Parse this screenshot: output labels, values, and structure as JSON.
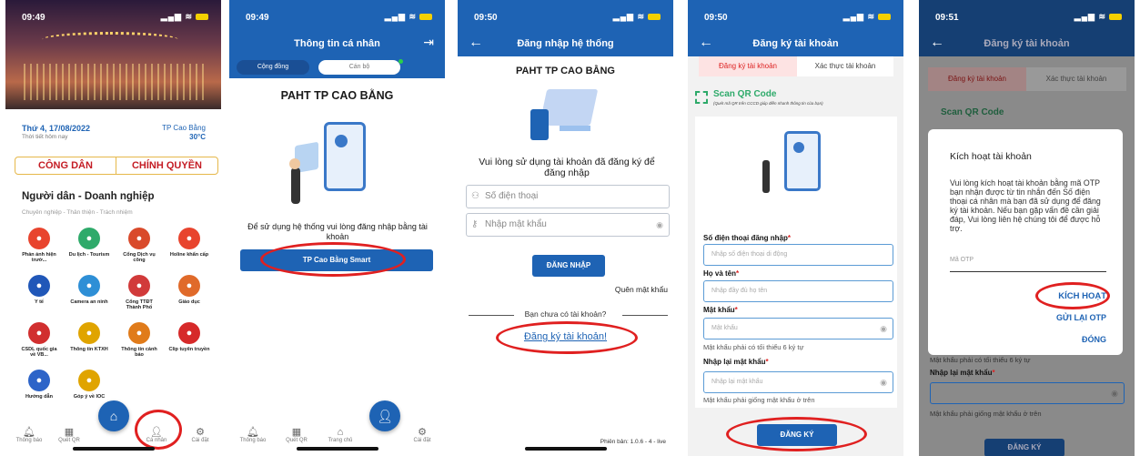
{
  "colors": {
    "brand_blue": "#1e63b4",
    "accent_red": "#d0112b",
    "annotation_red": "#e02020"
  },
  "s1": {
    "time": "09:49",
    "date": "Thứ 4, 17/08/2022",
    "weather_label": "Thời tiết hôm nay",
    "city": "TP Cao Bằng",
    "temp": "30°C",
    "tab_citizen": "CÔNG DÂN",
    "tab_gov": "CHÍNH QUYỀN",
    "section_title": "Người dân - Doanh nghiệp",
    "section_sub": "Chuyên nghiệp - Thân thiện - Trách nhiệm",
    "grid": [
      {
        "label": "Phản ánh hiện trườ...",
        "icon": "location-pin-icon",
        "color": "#e8442e"
      },
      {
        "label": "Du lịch - Tourism",
        "icon": "mountain-icon",
        "color": "#2eaa6a"
      },
      {
        "label": "Cổng Dịch vụ công",
        "icon": "service-portal-icon",
        "color": "#d94a2b"
      },
      {
        "label": "Holine khẩn cấp",
        "icon": "phone-icon",
        "color": "#e8442e"
      },
      {
        "label": "Y tế",
        "icon": "health-icon",
        "color": "#2057b8"
      },
      {
        "label": "Camera an ninh",
        "icon": "camera-icon",
        "color": "#2e8fd6"
      },
      {
        "label": "Cổng TTĐT Thành Phố",
        "icon": "portal-icon",
        "color": "#d13a3a"
      },
      {
        "label": "Giáo dục",
        "icon": "education-icon",
        "color": "#e06a2a"
      },
      {
        "label": "CSDL quốc gia về VB...",
        "icon": "database-icon",
        "color": "#d12f2f"
      },
      {
        "label": "Thông tin KTXH",
        "icon": "info-icon",
        "color": "#e0a400"
      },
      {
        "label": "Thông tin cảnh báo",
        "icon": "warning-icon",
        "color": "#e07b1a"
      },
      {
        "label": "Clip tuyên truyền",
        "icon": "clip-icon",
        "color": "#d62a2a"
      },
      {
        "label": "Hướng dẫn",
        "icon": "guide-icon",
        "color": "#2d64c8"
      },
      {
        "label": "Góp ý về IOC",
        "icon": "feedback-icon",
        "color": "#e0a400"
      }
    ],
    "nav": [
      "Thông báo",
      "Quét QR",
      "Cá nhân",
      "Cài đặt"
    ]
  },
  "s2": {
    "time": "09:49",
    "header": "Thông tin cá nhân",
    "seg_community": "Cộng đồng",
    "seg_staff": "Cán bộ",
    "title": "PAHT TP CAO BẰNG",
    "desc": "Để sử dụng hệ thống vui lòng đăng nhập bằng tài khoản",
    "button": "TP Cao Bằng Smart",
    "nav": [
      "Thông báo",
      "Quét QR",
      "Trang chủ",
      "Cài đặt"
    ]
  },
  "s3": {
    "time": "09:50",
    "header": "Đăng nhập hệ thống",
    "title": "PAHT TP CAO BẰNG",
    "desc": "Vui lòng sử dụng tài khoản đã đăng ký để đăng nhập",
    "phone_placeholder": "Số điện thoại",
    "password_placeholder": "Nhập mật khẩu",
    "login_button": "ĐĂNG NHẬP",
    "forgot": "Quên mật khẩu",
    "no_account": "Bạn chưa có tài khoản?",
    "register_link": "Đăng ký tài khoản!",
    "version": "Phiên bản: 1.0.6 - 4 - live"
  },
  "s4": {
    "time": "09:50",
    "header": "Đăng ký tài khoản",
    "tab_register": "Đăng ký tài khoản",
    "tab_verify": "Xác thực tài khoản",
    "scan_title": "Scan QR Code",
    "scan_sub": "(Quét mã QR trên CCCD giúp điền nhanh thông tin của bạn)",
    "phone_label": "Số điện thoại đăng nhập",
    "phone_placeholder": "Nhập số điện thoại di động",
    "name_label": "Họ và tên",
    "name_placeholder": "Nhập đầy đủ họ tên",
    "pw_label": "Mật khẩu",
    "pw_placeholder": "Mật khẩu",
    "pw_hint": "Mật khẩu phải có tối thiểu 6 ký tự",
    "pw2_label": "Nhập lại mật khẩu",
    "pw2_placeholder": "Nhập lại mật khẩu",
    "pw2_hint": "Mật khẩu phải giống mật khẩu ở trên",
    "submit": "ĐĂNG KÝ"
  },
  "s5": {
    "time": "09:51",
    "header": "Đăng ký tài khoản",
    "tab_register": "Đăng ký tài khoản",
    "tab_verify": "Xác thực tài khoản",
    "scan_title": "Scan QR Code",
    "modal_title": "Kích hoạt tài khoản",
    "modal_body": "Vui lòng kích hoạt tài khoản bằng mã OTP bạn nhận được từ tin nhắn đến Số điện thoại cá nhân mà bạn đã sử dụng để đăng ký tài khoản. Nếu bạn gặp vấn đề cần giải đáp, Vui lòng liên hệ chúng tôi để được hỗ trợ.",
    "otp_placeholder": "Mã OTP",
    "activate": "KÍCH HOẠT",
    "resend": "GỬI LẠI OTP",
    "close": "ĐÓNG",
    "pw_hint": "Mật khẩu phải có tối thiểu 6 ký tự",
    "pw2_label": "Nhập lại mật khẩu",
    "pw2_hint": "Mật khẩu phải giống mật khẩu ở trên",
    "submit": "ĐĂNG KÝ"
  }
}
